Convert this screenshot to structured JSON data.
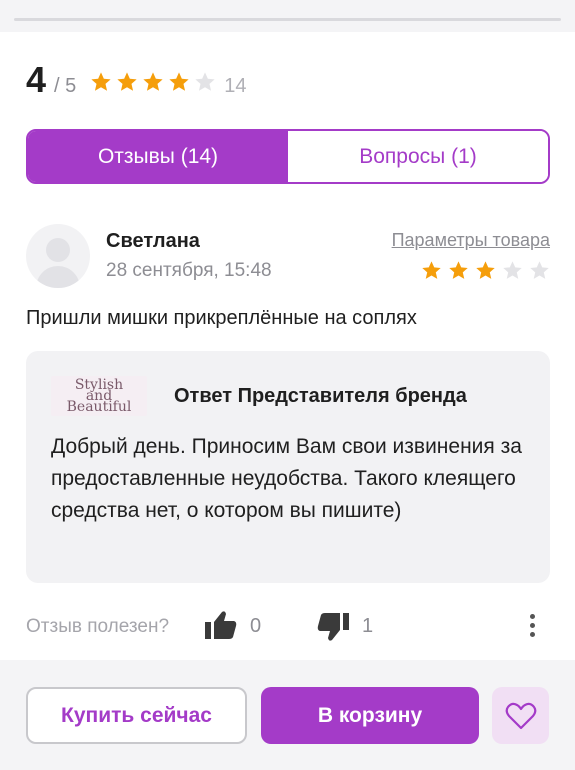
{
  "summary": {
    "rating": "4",
    "rating_max": "/ 5",
    "stars_filled": 4,
    "stars_total": 5,
    "review_count": "14"
  },
  "tabs": [
    {
      "label": "Отзывы (14)",
      "active": true
    },
    {
      "label": "Вопросы (1)",
      "active": false
    }
  ],
  "review": {
    "author": "Светлана",
    "date": "28 сентября, 15:48",
    "params_link": "Параметры товара",
    "stars_filled": 3,
    "stars_total": 5,
    "text": "Пришли мишки прикреплённые на соплях"
  },
  "answer": {
    "logo_text": [
      "Stylish",
      "and",
      "Beautiful"
    ],
    "title": "Ответ Представителя бренда",
    "text": "Добрый день. Приносим Вам свои извинения за предоставленные неудобства. Такого клеящего средства нет, о котором вы пишите)"
  },
  "helpful": {
    "label": "Отзыв полезен?",
    "likes": "0",
    "dislikes": "1"
  },
  "actions": {
    "buy_now": "Купить сейчас",
    "add_to_cart": "В корзину"
  },
  "colors": {
    "accent": "#a43bc8",
    "star": "#f59e0b",
    "star_empty": "#e3e3e6"
  },
  "icons": [
    "star-icon",
    "avatar-placeholder-icon",
    "thumb-up-icon",
    "thumb-down-icon",
    "more-vertical-icon",
    "heart-icon"
  ]
}
